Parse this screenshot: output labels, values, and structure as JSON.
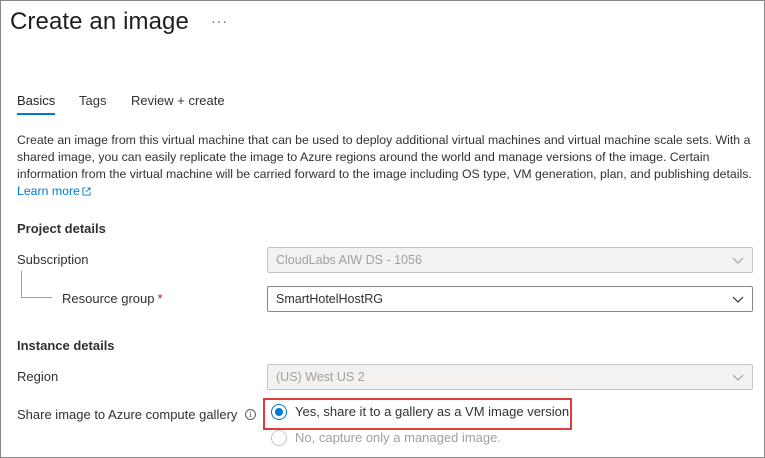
{
  "page": {
    "title": "Create an image",
    "more_menu": "···"
  },
  "tabs": [
    {
      "label": "Basics",
      "active": true
    },
    {
      "label": "Tags",
      "active": false
    },
    {
      "label": "Review + create",
      "active": false
    }
  ],
  "description": {
    "text": "Create an image from this virtual machine that can be used to deploy additional virtual machines and virtual machine scale sets. With a shared image, you can easily replicate the image to Azure regions around the world and manage versions of the image. Certain information from the virtual machine will be carried forward to the image including OS type, VM generation, plan, and publishing details.",
    "learn_more": "Learn more",
    "learn_more_icon": "external-link-icon"
  },
  "project_details": {
    "heading": "Project details",
    "subscription": {
      "label": "Subscription",
      "value": "CloudLabs AIW DS - 1056",
      "disabled": true
    },
    "resource_group": {
      "label": "Resource group",
      "required_marker": "*",
      "value": "SmartHotelHostRG",
      "disabled": false
    }
  },
  "instance_details": {
    "heading": "Instance details",
    "region": {
      "label": "Region",
      "value": "(US) West US 2",
      "disabled": true
    },
    "share_gallery": {
      "label": "Share image to Azure compute gallery",
      "info_icon": "i",
      "options": [
        {
          "label": "Yes, share it to a gallery as a VM image version.",
          "selected": true,
          "disabled": false
        },
        {
          "label": "No, capture only a managed image.",
          "selected": false,
          "disabled": true
        }
      ]
    }
  },
  "colors": {
    "accent": "#0078d4",
    "highlight": "#e03c3c",
    "required": "#a4262c"
  }
}
